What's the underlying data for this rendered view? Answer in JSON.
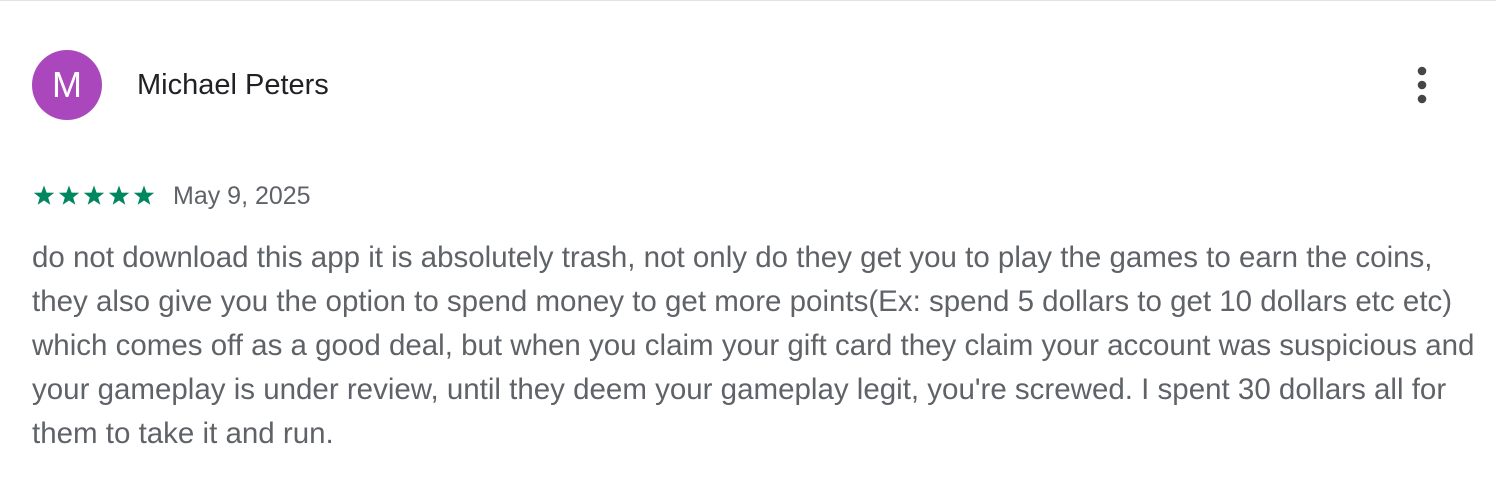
{
  "review": {
    "avatar_letter": "M",
    "avatar_color": "#ab47bc",
    "reviewer_name": "Michael Peters",
    "more_icon": "more-vert-icon",
    "rating": 5,
    "rating_max": 5,
    "star_color": "#01875f",
    "date": "May 9, 2025",
    "text": "do not download this app it is absolutely trash, not only do they get you to play the games to earn the coins, they also give you the option to spend money to get more points(Ex: spend 5 dollars to get 10 dollars etc etc) which comes off as a good deal, but when you claim your gift card they claim your account was suspicious and your gameplay is under review, until they deem your gameplay legit, you're screwed. I spent 30 dollars all for them to take it and run."
  }
}
